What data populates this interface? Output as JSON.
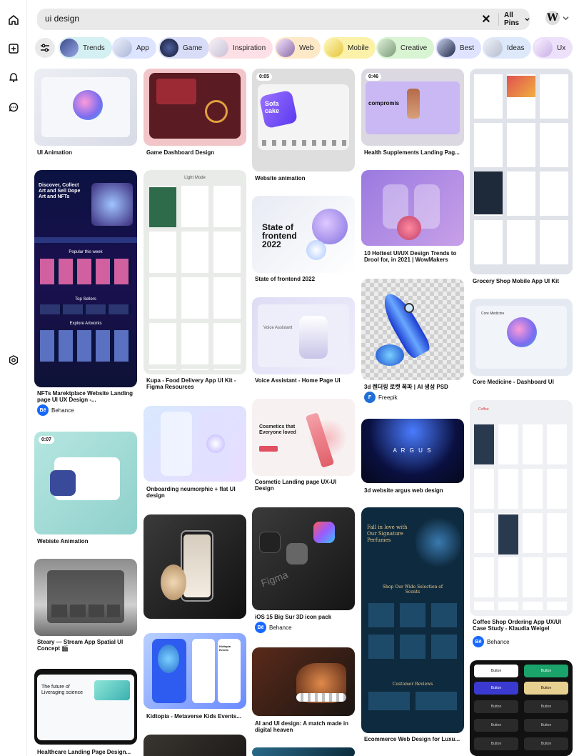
{
  "search": {
    "query": "ui design",
    "clear_icon": "close-icon",
    "scope_label": "All Pins"
  },
  "brand": {
    "letter": "W"
  },
  "chips": [
    {
      "label": "Trends",
      "bg": "#d4f0f2",
      "thumb": "#5566aa"
    },
    {
      "label": "App",
      "bg": "#dde4ff",
      "thumb": "#c9d2ea"
    },
    {
      "label": "Game",
      "bg": "#d8dcf6",
      "thumb": "#222848"
    },
    {
      "label": "Inspiration",
      "bg": "#fde0e6",
      "thumb": "#e6e2ec"
    },
    {
      "label": "Web",
      "bg": "#fde8c8",
      "thumb": "#8a6aa8"
    },
    {
      "label": "Mobile",
      "bg": "#fbf1a8",
      "thumb": "#f0d95a"
    },
    {
      "label": "Creative",
      "bg": "#d8f4d2",
      "thumb": "#98b894"
    },
    {
      "label": "Best",
      "bg": "#dfe3ff",
      "thumb": "#26304e"
    },
    {
      "label": "Ideas",
      "bg": "#dde9fa",
      "thumb": "#cfd7e8"
    },
    {
      "label": "Ux",
      "bg": "#ece0fa",
      "thumb": "#d8c4ee"
    }
  ],
  "pins": [
    {
      "title": "UI Animation"
    },
    {
      "title": "NFTs Marektplace Website Landing page UI UX Design -...",
      "source": "Behance"
    },
    {
      "title": "",
      "duration": "0:07"
    },
    {
      "title": "Webiste Animation"
    },
    {
      "title": "Steary — Stream App Spatial UI Concept 🎬"
    },
    {
      "title": "Healthcare Landing Page Design..."
    },
    {
      "title": "Game Dashboard Design"
    },
    {
      "title": "Kupa - Food Delivery App UI Kit - Figma Resources"
    },
    {
      "title": "Onboarding neumorphic + flat UI design"
    },
    {
      "title": ""
    },
    {
      "title": "Kidtopia - Metaverse Kids Events..."
    },
    {
      "title": "Website animation",
      "duration": "0:05"
    },
    {
      "title": "State of frontend 2022"
    },
    {
      "title": "Voice Assistant - Home Page UI"
    },
    {
      "title": "Cosmetic Landing page UX-UI Design"
    },
    {
      "title": "iOS 15 Big Sur 3D icon pack",
      "source": "Behance"
    },
    {
      "title": "AI and UI design: A match made in digital heaven"
    },
    {
      "title": "Health Supplements Landing Pag...",
      "duration": "0:46"
    },
    {
      "title": "10 Hottest UI/UX Design Trends to Drool for, in 2021 | WowMakers"
    },
    {
      "title": "3d 렌더링 로켓 폭파 | AI 생성 PSD",
      "source": "Freepik"
    },
    {
      "title": "3d website argus web design"
    },
    {
      "title": "Ecommerce Web Design for Luxu..."
    },
    {
      "title": "Grocery Shop Mobile App UI Kit"
    },
    {
      "title": "Core Medicine - Dashboard UI"
    },
    {
      "title": "Coffee Shop Ordering App UX/UI Case Study - Klaudia Weigel",
      "source": "Behance"
    }
  ],
  "art": {
    "nft_headline": "Discover, Collect Art and Sell Dope Art and NFTs",
    "nft_popular": "Popular this week",
    "nft_sellers": "Top Sellers",
    "nft_explore": "Explore Artworks",
    "frontend": "State of frontend 2022",
    "cosmetics": "Cosmetics that Everyone loved",
    "argus": "A R G U S",
    "perfume": "Fall in love with Our Signature Perfumes",
    "perfume_section": "Shop Our Wide Selection of Scents",
    "perfume_reviews": "Customer Reviews",
    "figma": "Figma",
    "health": "The future of Liveraging science",
    "supplement": "compromis",
    "button_label": "Button",
    "kupa_mode": "Light Mode",
    "kidtopia": "Kidtopia Events",
    "sofa": "Sofa cake",
    "voice": "Voice Assistant",
    "core": "Core Medicine",
    "coffee": "Coffee"
  }
}
